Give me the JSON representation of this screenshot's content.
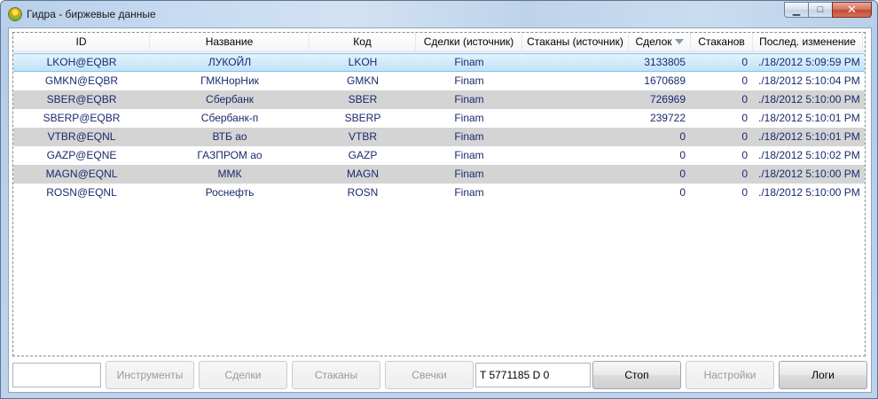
{
  "window": {
    "title": "Гидра - биржевые данные",
    "minimize_glyph": "▁",
    "maximize_glyph": "□",
    "close_glyph": "✕"
  },
  "grid": {
    "columns": [
      {
        "key": "id",
        "label": "ID",
        "width": 154,
        "align": "center"
      },
      {
        "key": "name",
        "label": "Название",
        "width": 180,
        "align": "center"
      },
      {
        "key": "code",
        "label": "Код",
        "width": 120,
        "align": "center"
      },
      {
        "key": "trades_src",
        "label": "Сделки (источник)",
        "width": 120,
        "align": "center"
      },
      {
        "key": "depth_src",
        "label": "Стаканы (источник)",
        "width": 120,
        "align": "center"
      },
      {
        "key": "trades",
        "label": "Сделок",
        "width": 70,
        "align": "right",
        "sorted": true
      },
      {
        "key": "depths",
        "label": "Стаканов",
        "width": 70,
        "align": "right"
      },
      {
        "key": "last_change",
        "label": "Послед. изменение",
        "width": 124,
        "align": "left"
      }
    ],
    "rows": [
      {
        "id": "LKOH@EQBR",
        "name": "ЛУКОЙЛ",
        "code": "LKOH",
        "trades_src": "Finam",
        "depth_src": "",
        "trades": "3133805",
        "depths": "0",
        "last_change": "./18/2012 5:09:59 PM",
        "style": "sel"
      },
      {
        "id": "GMKN@EQBR",
        "name": "ГМКНорНик",
        "code": "GMKN",
        "trades_src": "Finam",
        "depth_src": "",
        "trades": "1670689",
        "depths": "0",
        "last_change": "./18/2012 5:10:04 PM",
        "style": ""
      },
      {
        "id": "SBER@EQBR",
        "name": "Сбербанк",
        "code": "SBER",
        "trades_src": "Finam",
        "depth_src": "",
        "trades": "726969",
        "depths": "0",
        "last_change": "./18/2012 5:10:00 PM",
        "style": "alt"
      },
      {
        "id": "SBERP@EQBR",
        "name": "Сбербанк-п",
        "code": "SBERP",
        "trades_src": "Finam",
        "depth_src": "",
        "trades": "239722",
        "depths": "0",
        "last_change": "./18/2012 5:10:01 PM",
        "style": ""
      },
      {
        "id": "VTBR@EQNL",
        "name": "ВТБ ао",
        "code": "VTBR",
        "trades_src": "Finam",
        "depth_src": "",
        "trades": "0",
        "depths": "0",
        "last_change": "./18/2012 5:10:01 PM",
        "style": "alt"
      },
      {
        "id": "GAZP@EQNE",
        "name": "ГАЗПРОМ ао",
        "code": "GAZP",
        "trades_src": "Finam",
        "depth_src": "",
        "trades": "0",
        "depths": "0",
        "last_change": "./18/2012 5:10:02 PM",
        "style": ""
      },
      {
        "id": "MAGN@EQNL",
        "name": "ММК",
        "code": "MAGN",
        "trades_src": "Finam",
        "depth_src": "",
        "trades": "0",
        "depths": "0",
        "last_change": "./18/2012 5:10:00 PM",
        "style": "alt"
      },
      {
        "id": "ROSN@EQNL",
        "name": "Роснефть",
        "code": "ROSN",
        "trades_src": "Finam",
        "depth_src": "",
        "trades": "0",
        "depths": "0",
        "last_change": "./18/2012 5:10:00 PM",
        "style": ""
      }
    ]
  },
  "toolbar": {
    "filter_value": "",
    "instruments_label": "Инструменты",
    "trades_label": "Сделки",
    "depths_label": "Стаканы",
    "candles_label": "Свечки",
    "status_value": "T 5771185 D 0",
    "stop_label": "Стоп",
    "settings_label": "Настройки",
    "logs_label": "Логи"
  }
}
